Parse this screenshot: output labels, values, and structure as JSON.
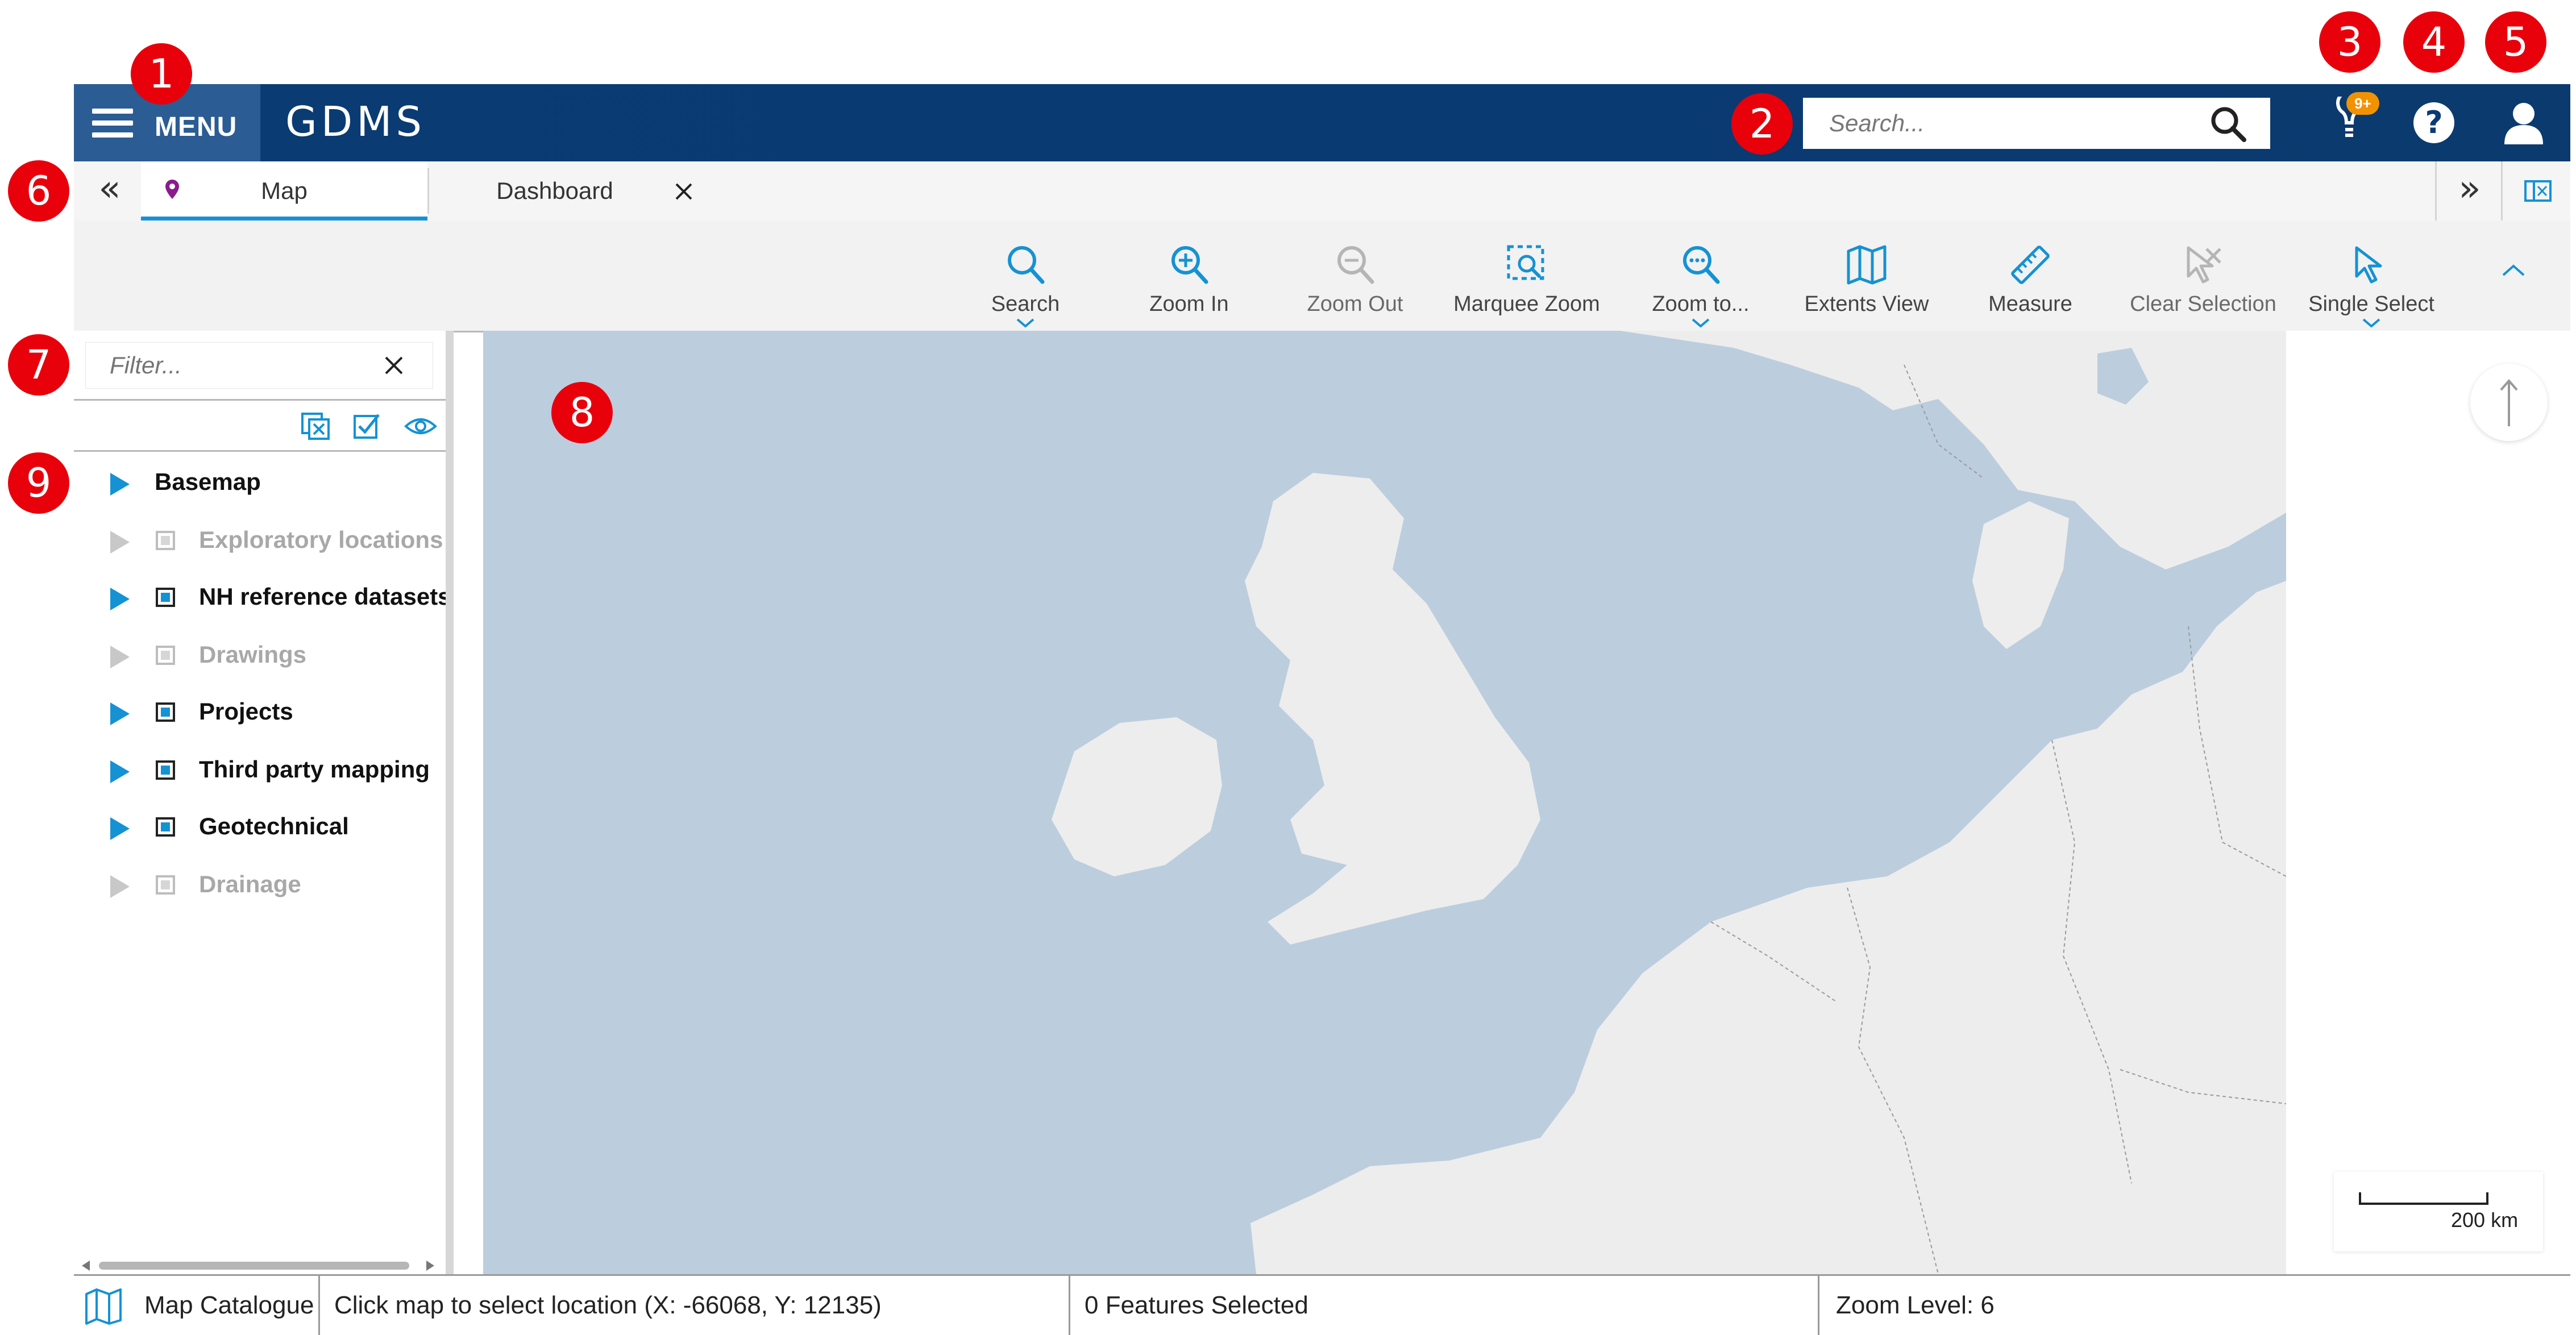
{
  "colors": {
    "header_bg": "#0a3b73",
    "menu_bg": "#2b5c93",
    "accent": "#1592d3",
    "tab_pin": "#8b1a8b",
    "callout": "#e8000b",
    "badge": "#f39200",
    "sea": "#bccdde",
    "land": "#ededed"
  },
  "header": {
    "menu_label": "MENU",
    "app_title": "GDMS",
    "search_placeholder": "Search...",
    "notifications_badge": "9+",
    "icons": [
      "menu-icon",
      "search-icon",
      "lightbulb-icon",
      "help-icon",
      "user-icon"
    ]
  },
  "tabs": {
    "items": [
      {
        "label": "Map",
        "icon": "pin-icon",
        "active": true
      },
      {
        "label": "Dashboard",
        "closable": true
      }
    ]
  },
  "toolbar": {
    "tools": [
      {
        "label": "Search",
        "icon": "search-icon",
        "dropdown": true,
        "enabled": true
      },
      {
        "label": "Zoom In",
        "icon": "zoom-in-icon",
        "enabled": true
      },
      {
        "label": "Zoom Out",
        "icon": "zoom-out-icon",
        "enabled": false
      },
      {
        "label": "Marquee Zoom",
        "icon": "marquee-zoom-icon",
        "enabled": true
      },
      {
        "label": "Zoom to...",
        "icon": "zoom-to-icon",
        "dropdown": true,
        "enabled": true
      },
      {
        "label": "Extents View",
        "icon": "map-icon",
        "enabled": true
      },
      {
        "label": "Measure",
        "icon": "ruler-icon",
        "enabled": true
      },
      {
        "label": "Clear Selection",
        "icon": "clear-selection-icon",
        "enabled": false
      },
      {
        "label": "Single Select",
        "icon": "cursor-icon",
        "dropdown": true,
        "enabled": true
      }
    ]
  },
  "layers_panel": {
    "filter_placeholder": "Filter...",
    "layers": [
      {
        "name": "Basemap",
        "checkbox": false,
        "enabled": true
      },
      {
        "name": "Exploratory locations",
        "checkbox": true,
        "enabled": false
      },
      {
        "name": "NH reference datasets",
        "checkbox": true,
        "enabled": true
      },
      {
        "name": "Drawings",
        "checkbox": true,
        "enabled": false
      },
      {
        "name": "Projects",
        "checkbox": true,
        "enabled": true
      },
      {
        "name": "Third party mapping",
        "checkbox": true,
        "enabled": true
      },
      {
        "name": "Geotechnical",
        "checkbox": true,
        "enabled": true
      },
      {
        "name": "Drainage",
        "checkbox": true,
        "enabled": false
      }
    ]
  },
  "map": {
    "scale_label": "200 km"
  },
  "status_bar": {
    "catalogue_label": "Map Catalogue",
    "location_text": "Click map to select location (X: -66068, Y: 12135)",
    "features_text": "0 Features Selected",
    "zoom_text": "Zoom Level: 6"
  },
  "callouts": [
    "1",
    "2",
    "3",
    "4",
    "5",
    "6",
    "7",
    "8",
    "9"
  ]
}
